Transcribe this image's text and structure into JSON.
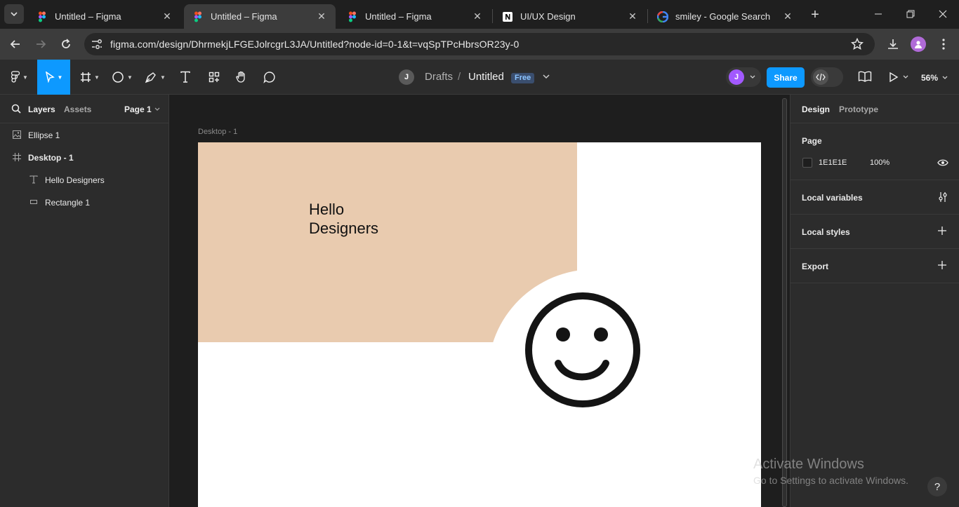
{
  "browser": {
    "tabs": [
      {
        "title": "Untitled – Figma",
        "favicon": "figma-icon",
        "active": false
      },
      {
        "title": "Untitled – Figma",
        "favicon": "figma-icon",
        "active": true
      },
      {
        "title": "Untitled – Figma",
        "favicon": "figma-icon",
        "active": false
      },
      {
        "title": "UI/UX Design",
        "favicon": "notion-icon",
        "active": false
      },
      {
        "title": "smiley - Google Search",
        "favicon": "google-icon",
        "active": false
      }
    ],
    "url": "figma.com/design/DhrmekjLFGEJolrcgrL3JA/Untitled?node-id=0-1&t=vqSpTPcHbrsOR23y-0"
  },
  "toolbar": {
    "project": "Drafts",
    "file": "Untitled",
    "plan_badge": "Free",
    "user_initial": "J",
    "share_label": "Share",
    "zoom": "56%"
  },
  "left_panel": {
    "tabs": [
      "Layers",
      "Assets"
    ],
    "page": "Page 1",
    "layers": [
      {
        "name": "Ellipse 1",
        "icon": "image-icon",
        "depth": 0
      },
      {
        "name": "Desktop - 1",
        "icon": "frame-icon",
        "depth": 0
      },
      {
        "name": "Hello Designers",
        "icon": "text-icon",
        "depth": 1
      },
      {
        "name": "Rectangle 1",
        "icon": "rectangle-icon",
        "depth": 1
      }
    ]
  },
  "canvas": {
    "frame_label": "Desktop - 1",
    "headline_line1": "Hello",
    "headline_line2": "Designers",
    "rect_color": "#E9CBAF"
  },
  "right_panel": {
    "tabs": [
      "Design",
      "Prototype"
    ],
    "page_label": "Page",
    "page_color": "1E1E1E",
    "page_opacity": "100%",
    "sections": [
      "Local variables",
      "Local styles",
      "Export"
    ]
  },
  "watermark": {
    "line1": "Activate Windows",
    "line2": "Go to Settings to activate Windows."
  },
  "colors": {
    "accent": "#0d99ff",
    "avatar": "#a259ff"
  }
}
